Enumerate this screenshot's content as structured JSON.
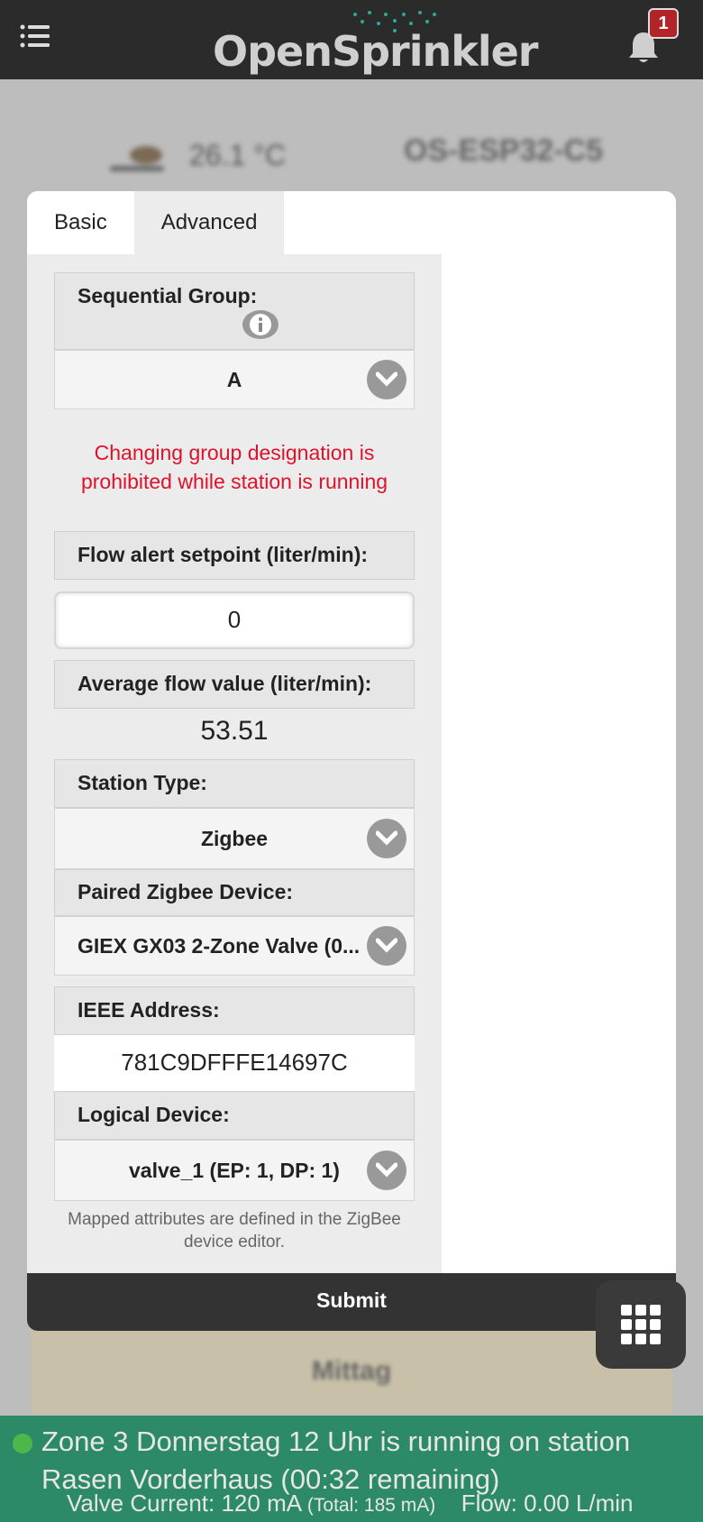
{
  "header": {
    "logo_text": "OpenSprinkler",
    "notification_count": "1"
  },
  "background": {
    "temperature": "26.1 °C",
    "device_name": "OS-ESP32-C5",
    "program_label": "Mittag"
  },
  "modal": {
    "tabs": [
      {
        "label": "Basic",
        "active": true
      },
      {
        "label": "Advanced",
        "active": false
      }
    ],
    "sequential_group": {
      "label": "Sequential Group:",
      "value": "A"
    },
    "warning_line1": "Changing group designation is",
    "warning_line2": "prohibited while station is running",
    "flow_alert": {
      "label": "Flow alert setpoint (liter/min):",
      "value": "0"
    },
    "average_flow": {
      "label": "Average flow value (liter/min):",
      "value": "53.51"
    },
    "station_type": {
      "label": "Station Type:",
      "value": "Zigbee"
    },
    "paired_device": {
      "label": "Paired Zigbee Device:",
      "value": "GIEX GX03 2-Zone Valve (0..."
    },
    "ieee_address": {
      "label": "IEEE Address:",
      "value": "781C9DFFFE14697C"
    },
    "logical_device": {
      "label": "Logical Device:",
      "value": "valve_1 (EP: 1, DP: 1)"
    },
    "note_line1": "Mapped attributes are defined in the ZigBee",
    "note_line2": "device editor.",
    "submit_label": "Submit"
  },
  "status_bar": {
    "message": "Zone 3 Donnerstag 12 Uhr is running on station Rasen Vorderhaus (00:32 remaining)",
    "valve_current": "Valve Current: 120 mA",
    "total": "(Total: 185 mA)",
    "flow": "Flow: 0.00 L/min"
  },
  "colors": {
    "header_bg": "#2b2b2b",
    "status_bg": "#2c8a66",
    "warning_text": "#e0112b",
    "badge_bg": "#b3232a"
  }
}
